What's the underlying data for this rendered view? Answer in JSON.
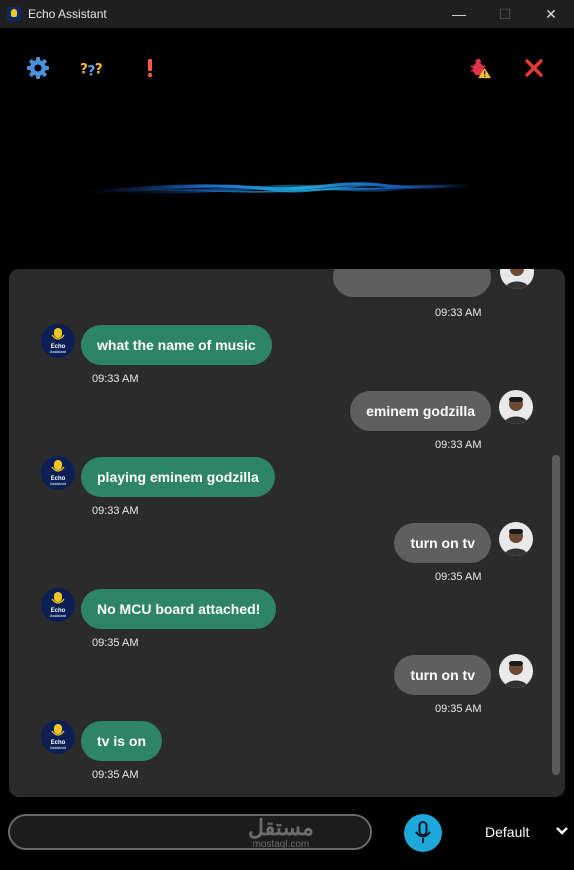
{
  "window": {
    "title": "Echo Assistant",
    "min": "—",
    "max": "☐",
    "close": "✕"
  },
  "avatars": {
    "bot_line1": "Echo",
    "bot_line2": "Assistant"
  },
  "messages": [
    {
      "from": "user",
      "text": "",
      "time": "09:33 AM"
    },
    {
      "from": "bot",
      "text": "what the name of music",
      "time": "09:33 AM"
    },
    {
      "from": "user",
      "text": "eminem godzilla",
      "time": "09:33 AM"
    },
    {
      "from": "bot",
      "text": "playing eminem godzilla",
      "time": "09:33 AM"
    },
    {
      "from": "user",
      "text": "turn on tv",
      "time": "09:35 AM"
    },
    {
      "from": "bot",
      "text": "No MCU board attached!",
      "time": "09:35 AM"
    },
    {
      "from": "user",
      "text": "turn on tv",
      "time": "09:35 AM"
    },
    {
      "from": "bot",
      "text": "tv is on",
      "time": "09:35 AM"
    }
  ],
  "input": {
    "value": "",
    "placeholder": ""
  },
  "watermark": {
    "arabic": "مستقل",
    "latin": "mostaql.com"
  },
  "voice": {
    "selected": "Default"
  },
  "colors": {
    "bot_bubble": "#2e8466",
    "user_bubble": "#5f5f5f",
    "mic": "#1ea7d9",
    "close": "#e53935"
  }
}
